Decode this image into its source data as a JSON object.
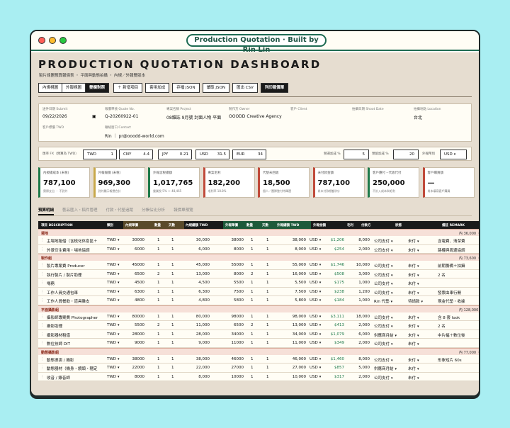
{
  "window": {
    "title": "Production Quotation · Built by Rin Lin",
    "dots": [
      "#ff5f57",
      "#febc2e",
      "#28c840"
    ]
  },
  "header": {
    "title": "PRODUCTION QUOTATION DASHBOARD",
    "subtitle": "製片總團預算報價表 ・ 平面與動態拍攝 ・ 內規／外報雙版本"
  },
  "toolbar": {
    "view_tabs": [
      "內規視圖",
      "外報視圖",
      "雙欄對照"
    ],
    "actions": [
      "＋ 新增項目",
      "套用加成",
      "存檔 JSON",
      "讀取 JSON",
      "匯出 CSV"
    ],
    "print": "列印報價單"
  },
  "info": {
    "fields": [
      {
        "label": "送件日期 Submit",
        "value": "09/22/2026"
      },
      {
        "label": "報價單號 Quote No.",
        "value": "Q-20260922-01"
      },
      {
        "label": "專案名稱 Project",
        "value": "08雜誌 9月號 封面人物 平面"
      },
      {
        "label": "製作方 Owner",
        "value": "OOODD Creative Agency"
      },
      {
        "label": "客戶 Client",
        "value": ""
      },
      {
        "label": "拍攝日期 Shoot Date",
        "value": ""
      },
      {
        "label": "拍攝地點 Location",
        "value": "台北"
      }
    ],
    "row2": [
      {
        "label": "客戶標價 TWD",
        "value": ""
      },
      {
        "label": "聯絡窗口 Contact",
        "value": "Rin ｜ pr@ooodd-world.com"
      }
    ]
  },
  "fx": {
    "label": "匯率 FX（預算為 TWD）",
    "rates": [
      {
        "c": "TWD",
        "v": "1"
      },
      {
        "c": "CNY",
        "v": "4.4"
      },
      {
        "c": "JPY",
        "v": "0.21"
      },
      {
        "c": "USD",
        "v": "31.5"
      },
      {
        "c": "EUR",
        "v": "34"
      }
    ],
    "mgmt_label": "營運加成 %",
    "mgmt": "5",
    "over_label": "預留加成 %",
    "over": "20",
    "cur_label": "外報幣別",
    "cur": "USD"
  },
  "stats": [
    {
      "l": "內規總成本 (未稅)",
      "v": "787,100",
      "n": "實際支出 ・ 不對外",
      "c": "#1e7a4a"
    },
    {
      "l": "外報報價 (未稅)",
      "v": "969,300",
      "n": "對外顯示報價合計",
      "c": "#c8a84a"
    },
    {
      "l": "外報含稅總額",
      "v": "1,017,765",
      "n": "營業稅 5% ＝ 48,465",
      "c": "#1e7a4a"
    },
    {
      "l": "專案毛利",
      "v": "182,200",
      "n": "毛利率 18.8%",
      "c": "#c04a3a"
    },
    {
      "l": "代墊未回收",
      "v": "18,500",
      "n": "個人／團隊墊付待歸還",
      "c": "#c04a3a"
    },
    {
      "l": "未付款金額",
      "v": "787,100",
      "n": "尚未付款總額(內)",
      "c": "#c04a3a"
    },
    {
      "l": "客戶應付・代收代付",
      "v": "250,000",
      "n": "不計入成本與毛利",
      "c": "#1e7a4a"
    },
    {
      "l": "客戶購買額",
      "v": "—",
      "n": "尚未填寫客戶購買",
      "c": "#c04a3a"
    }
  ],
  "subtabs": [
    "預算明細",
    "藝品匯入・稿件管理",
    "付款・代墊追蹤",
    "分帳佔比分析",
    "報價單預覽"
  ],
  "table": {
    "headers": [
      "項目 DESCRIPTION",
      "類別",
      "內規單價",
      "數量",
      "天數",
      "內規總額 TWD",
      "外報單價",
      "數量",
      "天數",
      "外報總額 TWD",
      "外報金額",
      "毛利",
      "付款方",
      "狀態",
      "備註 REMARK"
    ],
    "cats": [
      {
        "name": "場地",
        "total": "內 36,000 ・ 外",
        "rows": [
          [
            "主場地租借（含梳化休息區＋",
            "TWD",
            "30000",
            "1",
            "1",
            "30,000",
            "38000",
            "1",
            "1",
            "38,000",
            "USD",
            "$1,206",
            "8,000",
            "公司支付",
            "未付",
            "含電費、清潔費"
          ],
          [
            "外景衍生費用・場地協調",
            "TWD",
            "6000",
            "1",
            "1",
            "6,000",
            "8000",
            "1",
            "1",
            "8,000",
            "USD",
            "$254",
            "2,000",
            "公司支付",
            "未付",
            "路權與周邊協調"
          ]
        ]
      },
      {
        "name": "製作組",
        "total": "內 73,600 ・ 外",
        "rows": [
          [
            "製片專案費 Producer",
            "TWD",
            "45000",
            "1",
            "1",
            "45,000",
            "55000",
            "1",
            "1",
            "55,000",
            "USD",
            "$1,746",
            "10,000",
            "公司支付",
            "未付",
            "前期籌備＋拍攝"
          ],
          [
            "執行製片 / 製片助理",
            "TWD",
            "6500",
            "2",
            "1",
            "13,000",
            "8000",
            "2",
            "1",
            "16,000",
            "USD",
            "$508",
            "3,000",
            "公司支付",
            "未付",
            "2 名"
          ],
          [
            "場務",
            "TWD",
            "4500",
            "1",
            "1",
            "4,500",
            "5500",
            "1",
            "1",
            "5,500",
            "USD",
            "$175",
            "1,000",
            "公司支付",
            "未付",
            ""
          ],
          [
            "工作人員交通包車",
            "TWD",
            "6300",
            "1",
            "1",
            "6,300",
            "7500",
            "1",
            "1",
            "7,500",
            "USD",
            "$238",
            "1,200",
            "公司支付",
            "未付",
            "發票由車行開"
          ],
          [
            "工作人員餐飲・道具雜支",
            "TWD",
            "4800",
            "1",
            "1",
            "4,800",
            "5800",
            "1",
            "1",
            "5,800",
            "USD",
            "$184",
            "1,000",
            "Rin 代墊",
            "待請款",
            "現金代墊・收據"
          ]
        ]
      },
      {
        "name": "平面攝影組",
        "total": "內 128,000 ・ 外 15",
        "rows": [
          [
            "攝影師專案費 Photographer",
            "TWD",
            "80000",
            "1",
            "1",
            "80,000",
            "98000",
            "1",
            "1",
            "98,000",
            "USD",
            "$3,111",
            "18,000",
            "公司支付",
            "未付",
            "含 8 套 look"
          ],
          [
            "攝影助理",
            "TWD",
            "5500",
            "2",
            "1",
            "11,000",
            "6500",
            "2",
            "1",
            "13,000",
            "USD",
            "$413",
            "2,000",
            "公司支付",
            "未付",
            "2 名"
          ],
          [
            "攝影器材租借",
            "TWD",
            "28000",
            "1",
            "1",
            "28,000",
            "34000",
            "1",
            "1",
            "34,000",
            "USD",
            "$1,079",
            "6,000",
            "供應商月結",
            "未付",
            "中片幅＋數位後"
          ],
          [
            "數位技師 DIT",
            "TWD",
            "9000",
            "1",
            "1",
            "9,000",
            "11000",
            "1",
            "1",
            "11,000",
            "USD",
            "$349",
            "2,000",
            "公司支付",
            "未付",
            ""
          ]
        ]
      },
      {
        "name": "動態攝影組",
        "total": "內 77,000 ・ 外",
        "rows": [
          [
            "動態導演 / 攝影",
            "TWD",
            "38000",
            "1",
            "1",
            "38,000",
            "46000",
            "1",
            "1",
            "46,000",
            "USD",
            "$1,460",
            "8,000",
            "公司支付",
            "未付",
            "形象短片 60s"
          ],
          [
            "動態器材（機身・鏡頭・穩定",
            "TWD",
            "22000",
            "1",
            "1",
            "22,000",
            "27000",
            "1",
            "1",
            "27,000",
            "USD",
            "$857",
            "5,000",
            "供應商月結",
            "未付",
            ""
          ],
          [
            "收音 / 錄音師",
            "TWD",
            "8000",
            "1",
            "1",
            "8,000",
            "10000",
            "1",
            "1",
            "10,000",
            "USD",
            "$317",
            "2,000",
            "公司支付",
            "未付",
            ""
          ]
        ]
      }
    ]
  }
}
